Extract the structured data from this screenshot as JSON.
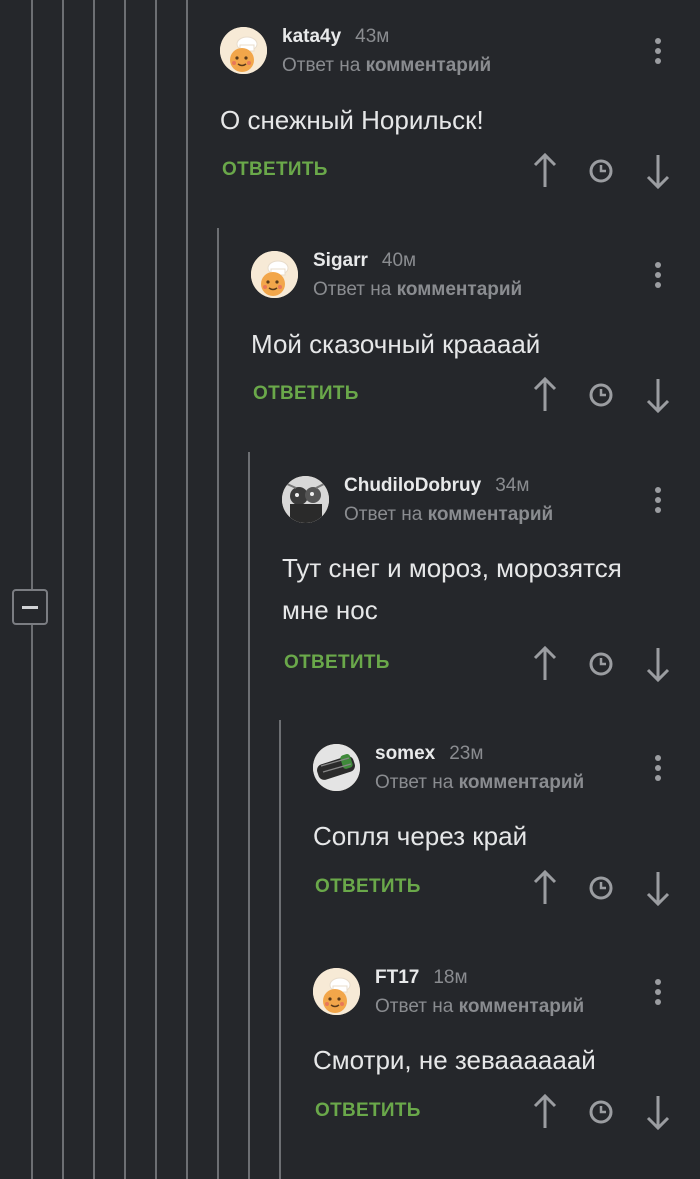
{
  "colors": {
    "background": "#25272b",
    "thread_line": "#6d6f73",
    "username": "#e8e9ea",
    "muted": "#8a8c90",
    "reply_green": "#6aa84a",
    "icon": "#9b9da1"
  },
  "reply_label": "ОТВЕТИТЬ",
  "comments": [
    {
      "username": "kata4y",
      "time": "43м",
      "reply_prefix": "Ответ на",
      "reply_target": "комментарий",
      "text": [
        "О снежный Норильск!"
      ],
      "avatar": "chef-cookie-avatar"
    },
    {
      "username": "Sigarr",
      "time": "40м",
      "reply_prefix": "Ответ на",
      "reply_target": "комментарий",
      "text": [
        "Мой сказочный краааай"
      ],
      "avatar": "chef-cookie-avatar"
    },
    {
      "username": "ChudiloDobruy",
      "time": "34м",
      "reply_prefix": "Ответ на",
      "reply_target": "комментарий",
      "text": [
        "Тут снег и мороз, морозятся",
        "мне нос"
      ],
      "avatar": "monochrome-photo-avatar"
    },
    {
      "username": "somex",
      "time": "23м",
      "reply_prefix": "Ответ на",
      "reply_target": "комментарий",
      "text": [
        "Сопля через край"
      ],
      "avatar": "cable-photo-avatar"
    },
    {
      "username": "FT17",
      "time": "18м",
      "reply_prefix": "Ответ на",
      "reply_target": "комментарий",
      "text": [
        "Смотри, не зеваааааай"
      ],
      "avatar": "chef-cookie-avatar"
    }
  ]
}
